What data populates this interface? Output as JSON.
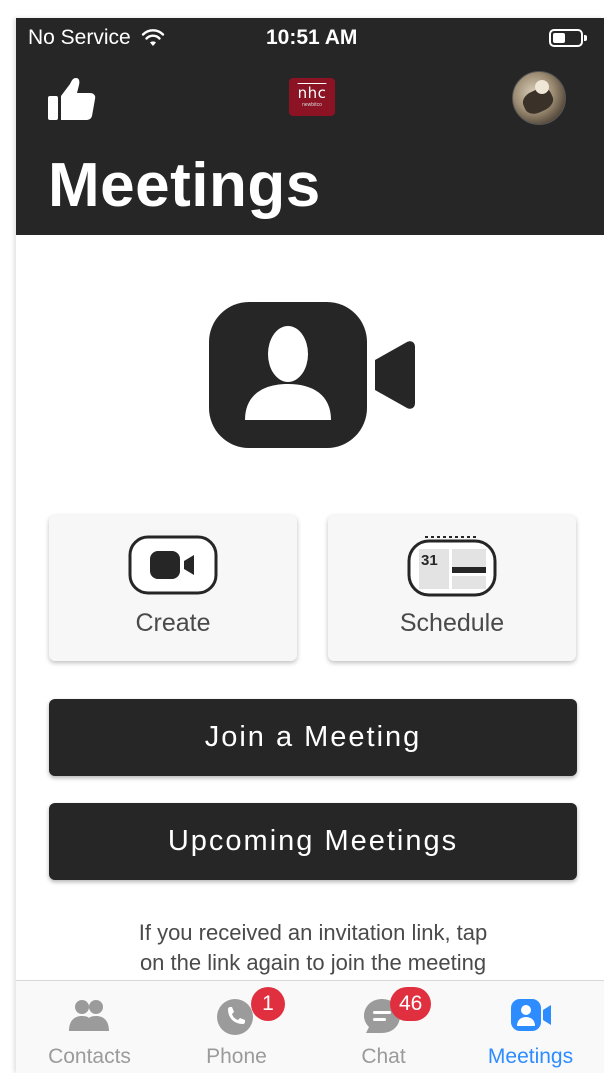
{
  "status_bar": {
    "carrier": "No Service",
    "time": "10:51 AM"
  },
  "header": {
    "logo_text": "nhc",
    "logo_subtext": "newbitco",
    "title": "Meetings"
  },
  "actions": {
    "create_label": "Create",
    "schedule_label": "Schedule",
    "calendar_day": "31"
  },
  "buttons": {
    "join": "Join a Meeting",
    "upcoming": "Upcoming Meetings"
  },
  "hint": {
    "line1": "If you received an invitation link, tap",
    "line2": "on the link again to join the meeting"
  },
  "tabs": [
    {
      "label": "Contacts",
      "icon": "contacts-icon",
      "badge": null,
      "active": false
    },
    {
      "label": "Phone",
      "icon": "phone-icon",
      "badge": "1",
      "active": false
    },
    {
      "label": "Chat",
      "icon": "chat-icon",
      "badge": "46",
      "active": false
    },
    {
      "label": "Meetings",
      "icon": "meetings-icon",
      "badge": null,
      "active": true
    }
  ],
  "colors": {
    "header_bg": "#262626",
    "accent": "#2d8cff",
    "badge": "#e0303f",
    "inactive_tab": "#9b9b9b"
  }
}
